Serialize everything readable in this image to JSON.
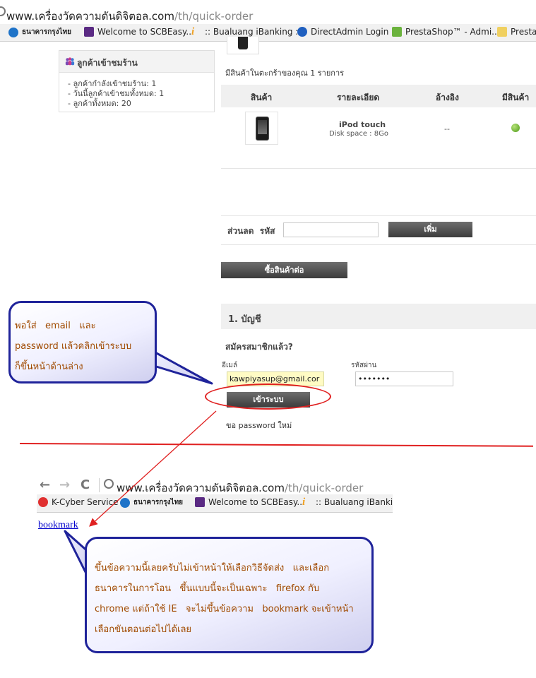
{
  "browser_top": {
    "url_domain": "www.เครื่องวัดความดันดิจิตอล.com",
    "url_path": "/th/quick-order",
    "bookmarks": [
      {
        "label": "ธนาคารกรุงไทย",
        "icon": "ktb-icon",
        "color": "#1e73c8"
      },
      {
        "label": "Welcome to SCBEasy...",
        "icon": "scb-icon",
        "color": "#5a2a83"
      },
      {
        "label": ":: Bualuang iBanking ::",
        "icon": "bualuang-icon",
        "color": "#f0a020"
      },
      {
        "label": "DirectAdmin Login",
        "icon": "directadmin-icon",
        "color": "#1f5fbf"
      },
      {
        "label": "PrestaShop™ - Admi...",
        "icon": "prestashop-icon",
        "color": "#6bb33d"
      },
      {
        "label": "PrestaS",
        "icon": "prestashop-icon",
        "color": "#f0d060"
      }
    ]
  },
  "visitors": {
    "title": "ลูกค้าเข้าชมร้าน",
    "lines": [
      "- ลูกค้ากำลังเข้าชมร้าน: 1",
      "- วันนี้ลูกค้าเข้าชมทั้งหมด: 1",
      "- ลูกค้าทั้งหมด: 20"
    ]
  },
  "cart": {
    "summary": "มีสินค้าในตะกร้าของคุณ 1 รายการ",
    "columns": [
      "สินค้า",
      "รายละเอียด",
      "อ้างอิง",
      "มีสินค้า"
    ],
    "item": {
      "name": "iPod touch",
      "desc": "Disk space : 8Go",
      "ref": "--"
    }
  },
  "voucher": {
    "label": "ส่วนลด  รหัส",
    "button": "เพิ่ม"
  },
  "continue_button": "ซื้อสินค้าต่อ",
  "account": {
    "title": "1. บัญชี",
    "member_label": "สมัครสมาชิกแล้ว?",
    "email_label": "อีเมล์",
    "email_value": "kawpiyasup@gmail.cor",
    "password_label": "รหัสผ่าน",
    "password_value": "•••••••",
    "login_button": "เข้าระบบ",
    "forgot": "ขอ password ใหม่"
  },
  "browser_second": {
    "url_domain": "www.เครื่องวัดความดันดิจิตอล.com",
    "url_path": "/th/quick-order",
    "bookmarks": [
      {
        "label": "K-Cyber Service",
        "icon": "kbank-icon",
        "color": "#e03030"
      },
      {
        "label": "ธนาคารกรุงไทย",
        "icon": "ktb-icon",
        "color": "#1e73c8"
      },
      {
        "label": "Welcome to SCBEasy...",
        "icon": "scb-icon",
        "color": "#5a2a83"
      },
      {
        "label": ":: Bualuang iBanking",
        "icon": "bualuang-icon",
        "color": "#f0a020"
      }
    ]
  },
  "bookmark_link": "bookmark",
  "callout_top": {
    "lines": [
      "พอใส่   email   และ",
      "password แล้วคลิกเข้าระบบ",
      "ก็ขึ้นหน้าด้านล่าง"
    ]
  },
  "callout_bottom": {
    "lines": [
      "ขึ้นข้อความนี้เลยครับไม่เข้าหน้าให้เลือกวิธีจัดส่ง   และเลือก",
      "ธนาคารในการโอน   ขึ้นแบบนี้จะเป็นเฉพาะ   firefox กับ",
      "chrome แต่ถ้าใช้ IE   จะไม่ขึ้นข้อความ   bookmark จะเข้าหน้า",
      "เลือกขันตอนต่อไปได้เลย"
    ]
  },
  "colors": {
    "annotation_red": "#e02020",
    "callout_border": "#1f239a",
    "callout_text": "#a04a00",
    "link_blue": "#0000cc"
  }
}
